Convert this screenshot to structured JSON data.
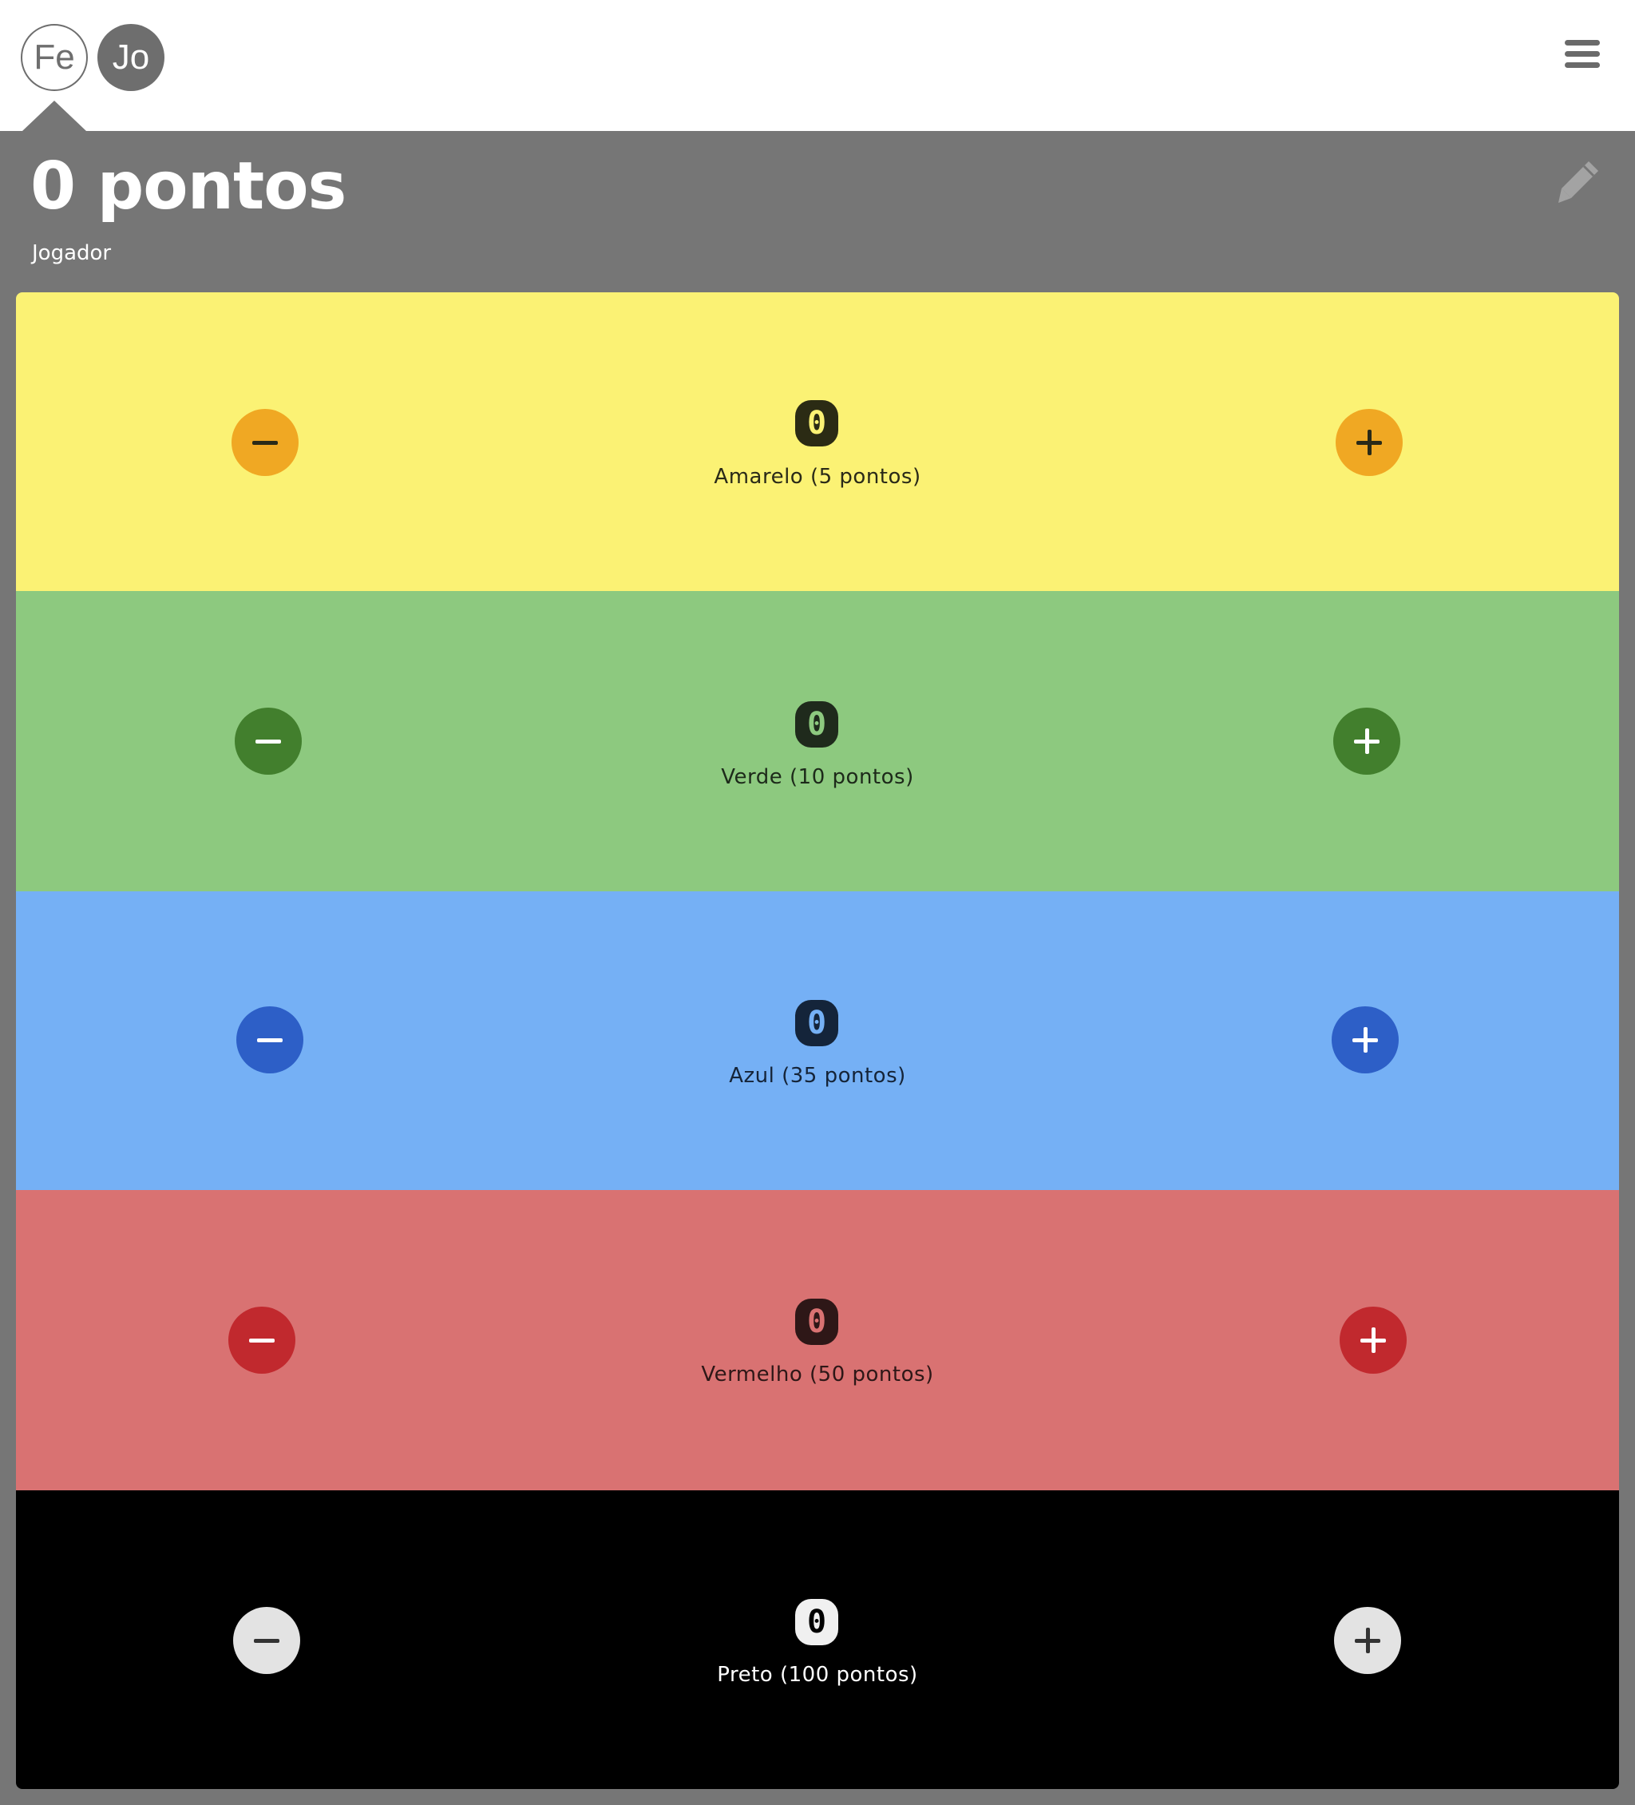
{
  "header": {
    "avatars": [
      {
        "initials": "Fe",
        "selected": false
      },
      {
        "initials": "Jo",
        "selected": true
      }
    ],
    "menu_icon": "hamburger-menu-icon"
  },
  "score": {
    "title": "0 pontos",
    "player_label": "Jogador",
    "edit_icon": "pencil-icon"
  },
  "rows": [
    {
      "key": "amarelo",
      "count": "0",
      "label": "Amarelo (5 pontos)",
      "colors": {
        "background": "#fbf274",
        "button": "#f0a823",
        "button_glyph": "#2a2a18",
        "count_bg": "#2b2b14",
        "count_fg": "#fbf274",
        "label": "#2a2a18"
      },
      "minus_icon": "minus-icon",
      "plus_icon": "plus-icon"
    },
    {
      "key": "verde",
      "count": "0",
      "label": "Verde (10 pontos)",
      "colors": {
        "background": "#8dc97f",
        "button": "#427f2d",
        "button_glyph": "#ffffff",
        "count_bg": "#1f2a1c",
        "count_fg": "#8dc97f",
        "label": "#1d2a1a"
      },
      "minus_icon": "minus-icon",
      "plus_icon": "plus-icon"
    },
    {
      "key": "azul",
      "count": "0",
      "label": "Azul (35 pontos)",
      "colors": {
        "background": "#75b0f5",
        "button": "#2d5fc7",
        "button_glyph": "#ffffff",
        "count_bg": "#14243a",
        "count_fg": "#75b0f5",
        "label": "#152438"
      },
      "minus_icon": "minus-icon",
      "plus_icon": "plus-icon"
    },
    {
      "key": "vermelho",
      "count": "0",
      "label": "Vermelho (50 pontos)",
      "colors": {
        "background": "#d97272",
        "button": "#c1292e",
        "button_glyph": "#ffffff",
        "count_bg": "#2e1717",
        "count_fg": "#d97272",
        "label": "#2e1717"
      },
      "minus_icon": "minus-icon",
      "plus_icon": "plus-icon"
    },
    {
      "key": "preto",
      "count": "0",
      "label": "Preto (100 pontos)",
      "colors": {
        "background": "#000000",
        "button": "#e3e3e3",
        "button_glyph": "#333333",
        "count_bg": "#f0f0f0",
        "count_fg": "#000000",
        "label": "#ffffff"
      },
      "minus_icon": "minus-icon",
      "plus_icon": "plus-icon"
    }
  ]
}
